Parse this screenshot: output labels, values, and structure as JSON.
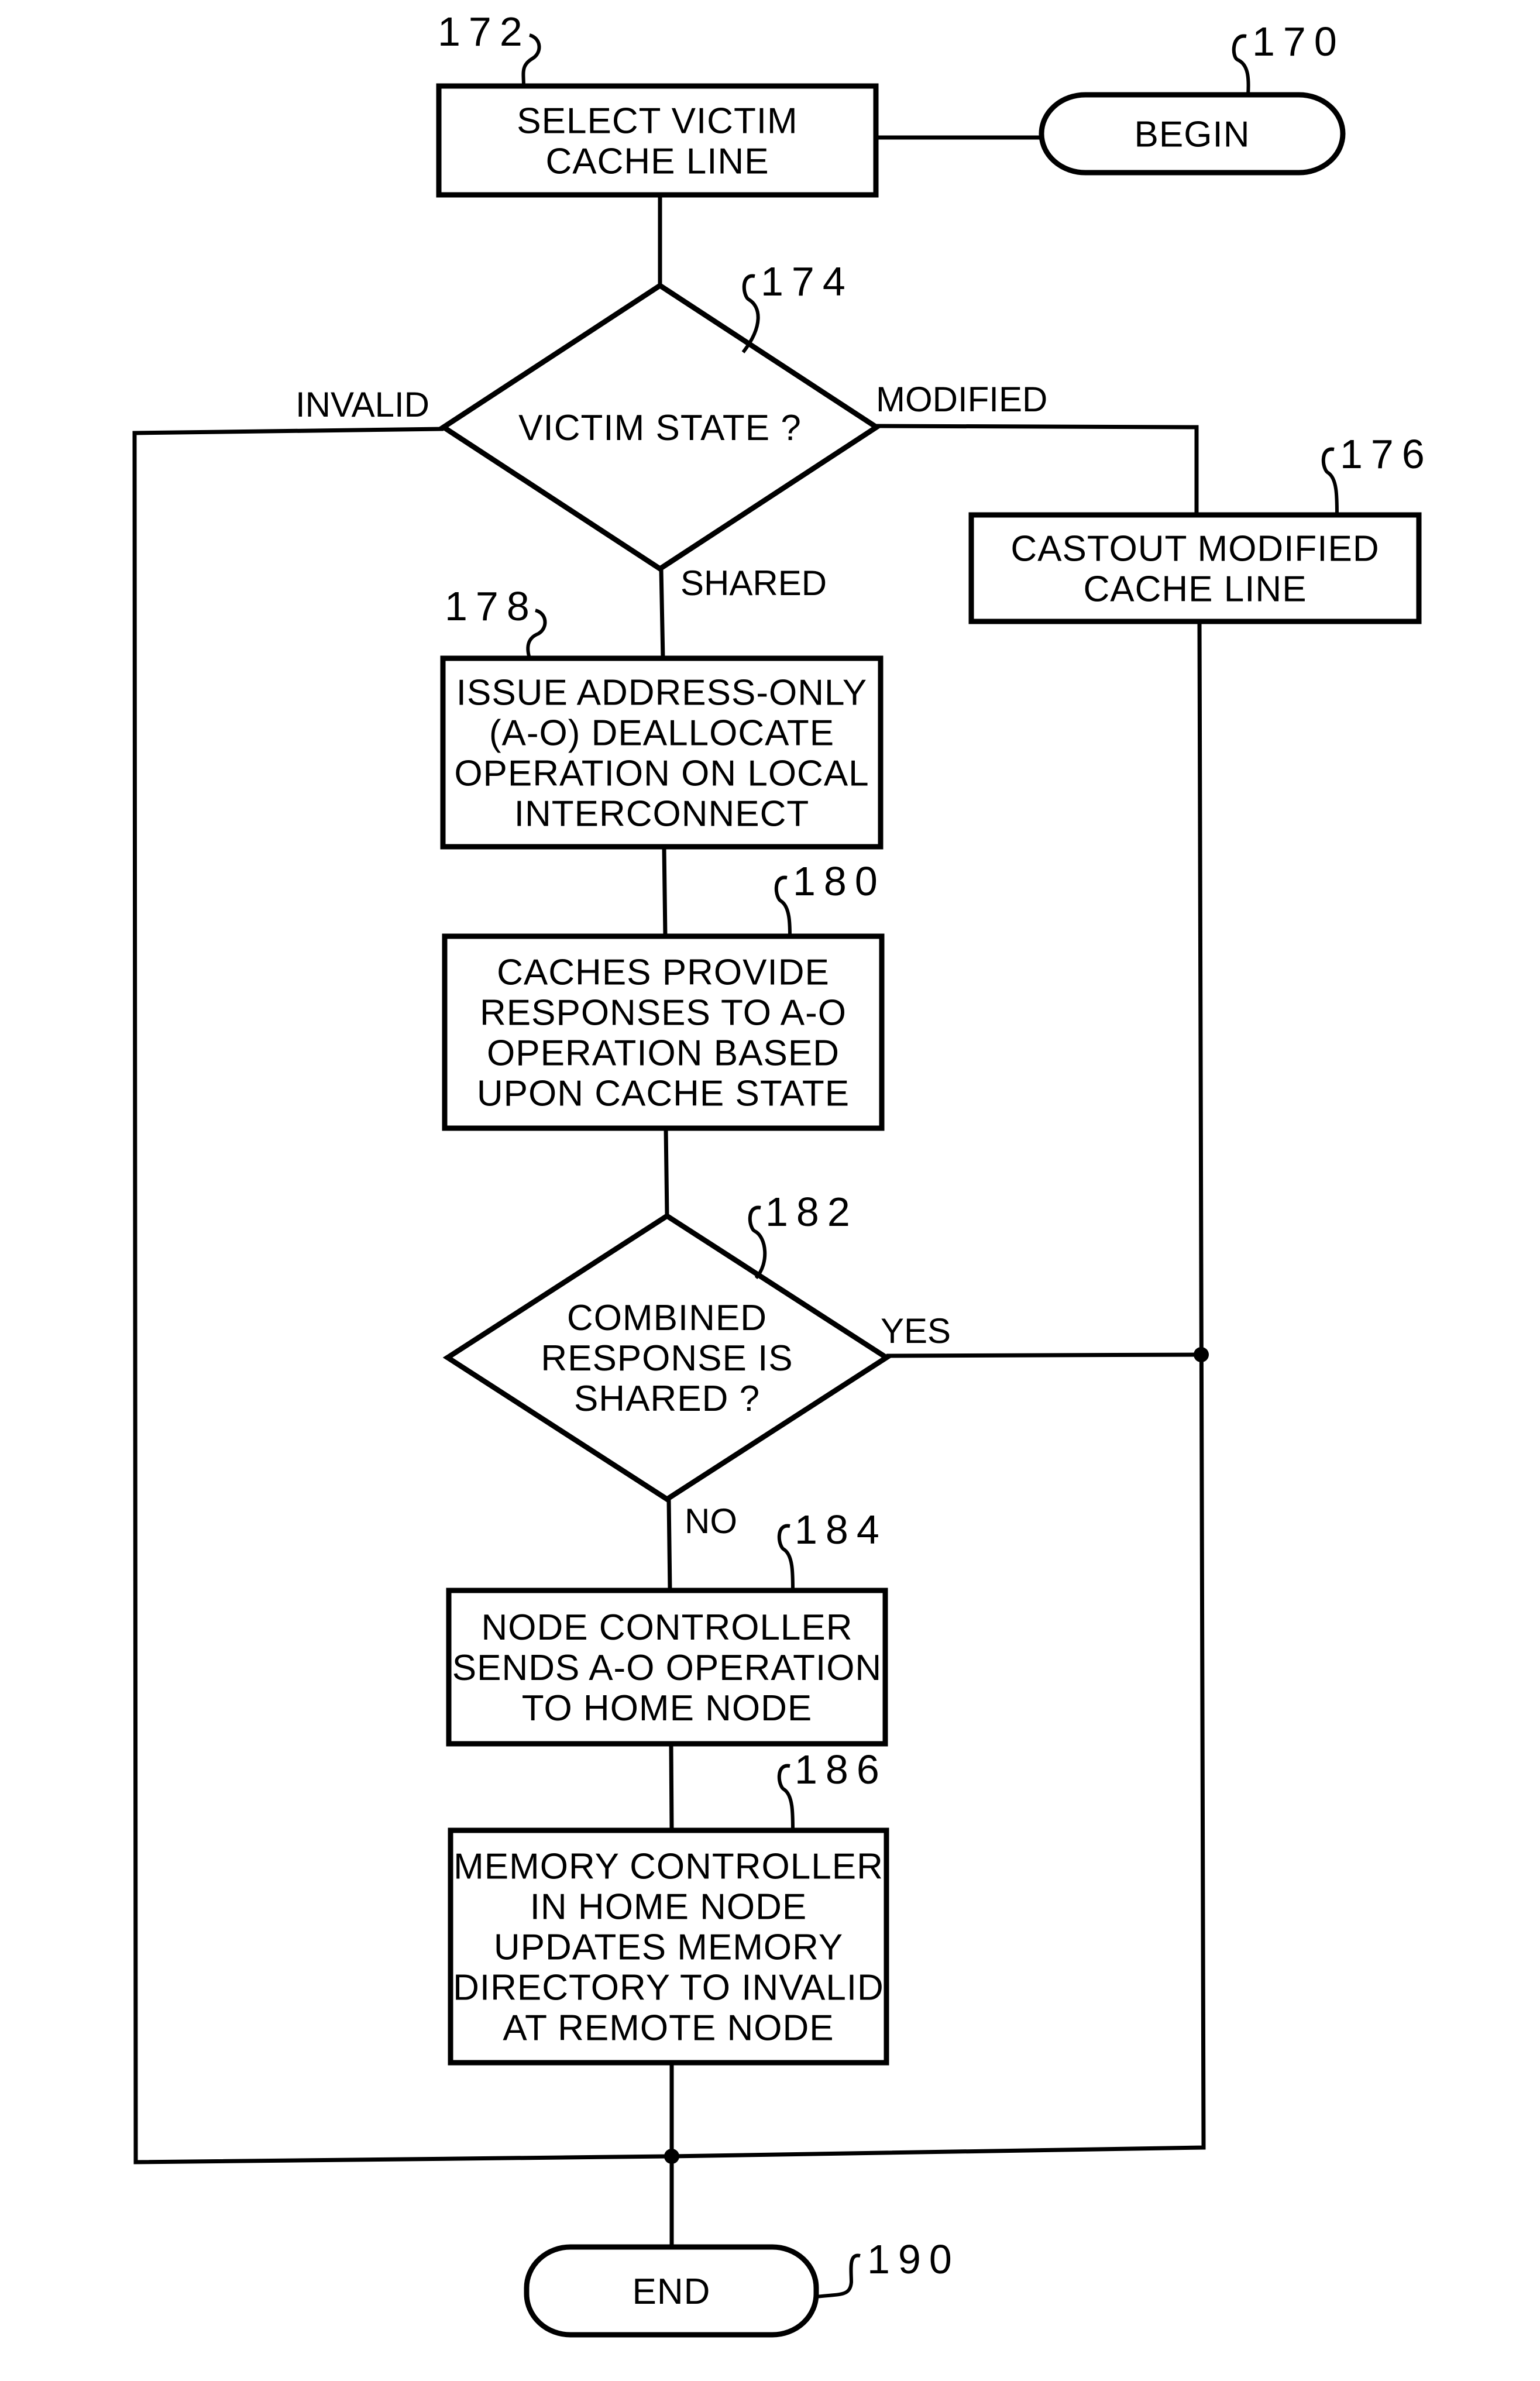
{
  "figure": {
    "type": "flowchart",
    "nodes": [
      {
        "id": "170",
        "ref": "170",
        "kind": "terminal",
        "lines": [
          "BEGIN"
        ]
      },
      {
        "id": "172",
        "ref": "172",
        "kind": "process",
        "lines": [
          "SELECT VICTIM",
          "CACHE LINE"
        ]
      },
      {
        "id": "174",
        "ref": "174",
        "kind": "decision",
        "lines": [
          "VICTIM STATE ?"
        ]
      },
      {
        "id": "176",
        "ref": "176",
        "kind": "process",
        "lines": [
          "CASTOUT MODIFIED",
          "CACHE LINE"
        ]
      },
      {
        "id": "178",
        "ref": "178",
        "kind": "process",
        "lines": [
          "ISSUE ADDRESS-ONLY",
          "(A-O) DEALLOCATE",
          "OPERATION ON LOCAL",
          "INTERCONNECT"
        ]
      },
      {
        "id": "180",
        "ref": "180",
        "kind": "process",
        "lines": [
          "CACHES PROVIDE",
          "RESPONSES TO A-O",
          "OPERATION BASED",
          "UPON CACHE STATE"
        ]
      },
      {
        "id": "182",
        "ref": "182",
        "kind": "decision",
        "lines": [
          "COMBINED",
          "RESPONSE IS",
          "SHARED ?"
        ]
      },
      {
        "id": "184",
        "ref": "184",
        "kind": "process",
        "lines": [
          "NODE CONTROLLER",
          "SENDS A-O OPERATION",
          "TO HOME NODE"
        ]
      },
      {
        "id": "186",
        "ref": "186",
        "kind": "process",
        "lines": [
          "MEMORY CONTROLLER",
          "IN HOME NODE",
          "UPDATES MEMORY",
          "DIRECTORY TO INVALID",
          "AT REMOTE NODE"
        ]
      },
      {
        "id": "190",
        "ref": "190",
        "kind": "terminal",
        "lines": [
          "END"
        ]
      }
    ],
    "edges": [
      {
        "from": "170",
        "to": "172",
        "label": ""
      },
      {
        "from": "172",
        "to": "174",
        "label": ""
      },
      {
        "from": "174",
        "to": "190",
        "label": "INVALID"
      },
      {
        "from": "174",
        "to": "176",
        "label": "MODIFIED"
      },
      {
        "from": "174",
        "to": "178",
        "label": "SHARED"
      },
      {
        "from": "176",
        "to": "190",
        "label": ""
      },
      {
        "from": "178",
        "to": "180",
        "label": ""
      },
      {
        "from": "180",
        "to": "182",
        "label": ""
      },
      {
        "from": "182",
        "to": "190",
        "label": "YES"
      },
      {
        "from": "182",
        "to": "184",
        "label": "NO"
      },
      {
        "from": "184",
        "to": "186",
        "label": ""
      },
      {
        "from": "186",
        "to": "190",
        "label": ""
      }
    ]
  }
}
